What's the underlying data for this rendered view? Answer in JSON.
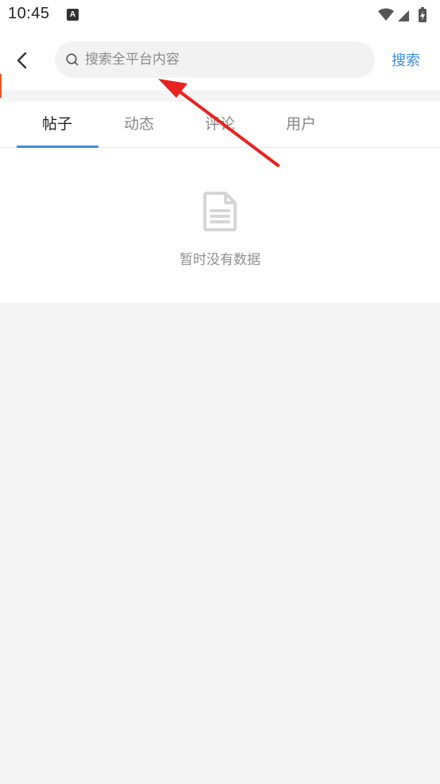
{
  "status_bar": {
    "time": "10:45",
    "app_icon_letter": "A",
    "icons": [
      "wifi-icon",
      "signal-icon",
      "battery-charging-icon"
    ]
  },
  "header": {
    "back_icon": "chevron-left-icon",
    "search_icon": "search-icon",
    "search_placeholder": "搜索全平台内容",
    "search_value": "",
    "search_button_label": "搜索"
  },
  "tabs": [
    {
      "label": "帖子",
      "active": true
    },
    {
      "label": "动态",
      "active": false
    },
    {
      "label": "评论",
      "active": false
    },
    {
      "label": "用户",
      "active": false
    }
  ],
  "empty_state": {
    "icon": "document-icon",
    "message": "暂时没有数据"
  },
  "colors": {
    "accent": "#3a8ee6",
    "annotation": "#e8231f",
    "background": "#f4f4f4"
  }
}
